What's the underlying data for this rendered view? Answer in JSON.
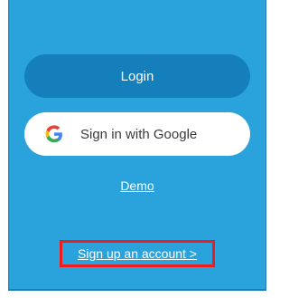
{
  "login_button": {
    "label": "Login"
  },
  "google_button": {
    "label": "Sign in with Google",
    "icon": "google-g-icon"
  },
  "demo_link": {
    "label": "Demo"
  },
  "signup_link": {
    "label": "Sign up an account >"
  },
  "colors": {
    "panel_background": "#2aa2dc",
    "login_button": "#157fbb",
    "google_button": "#ffffff",
    "highlight_border": "#ee1c1c",
    "text_light": "#ffffff"
  }
}
